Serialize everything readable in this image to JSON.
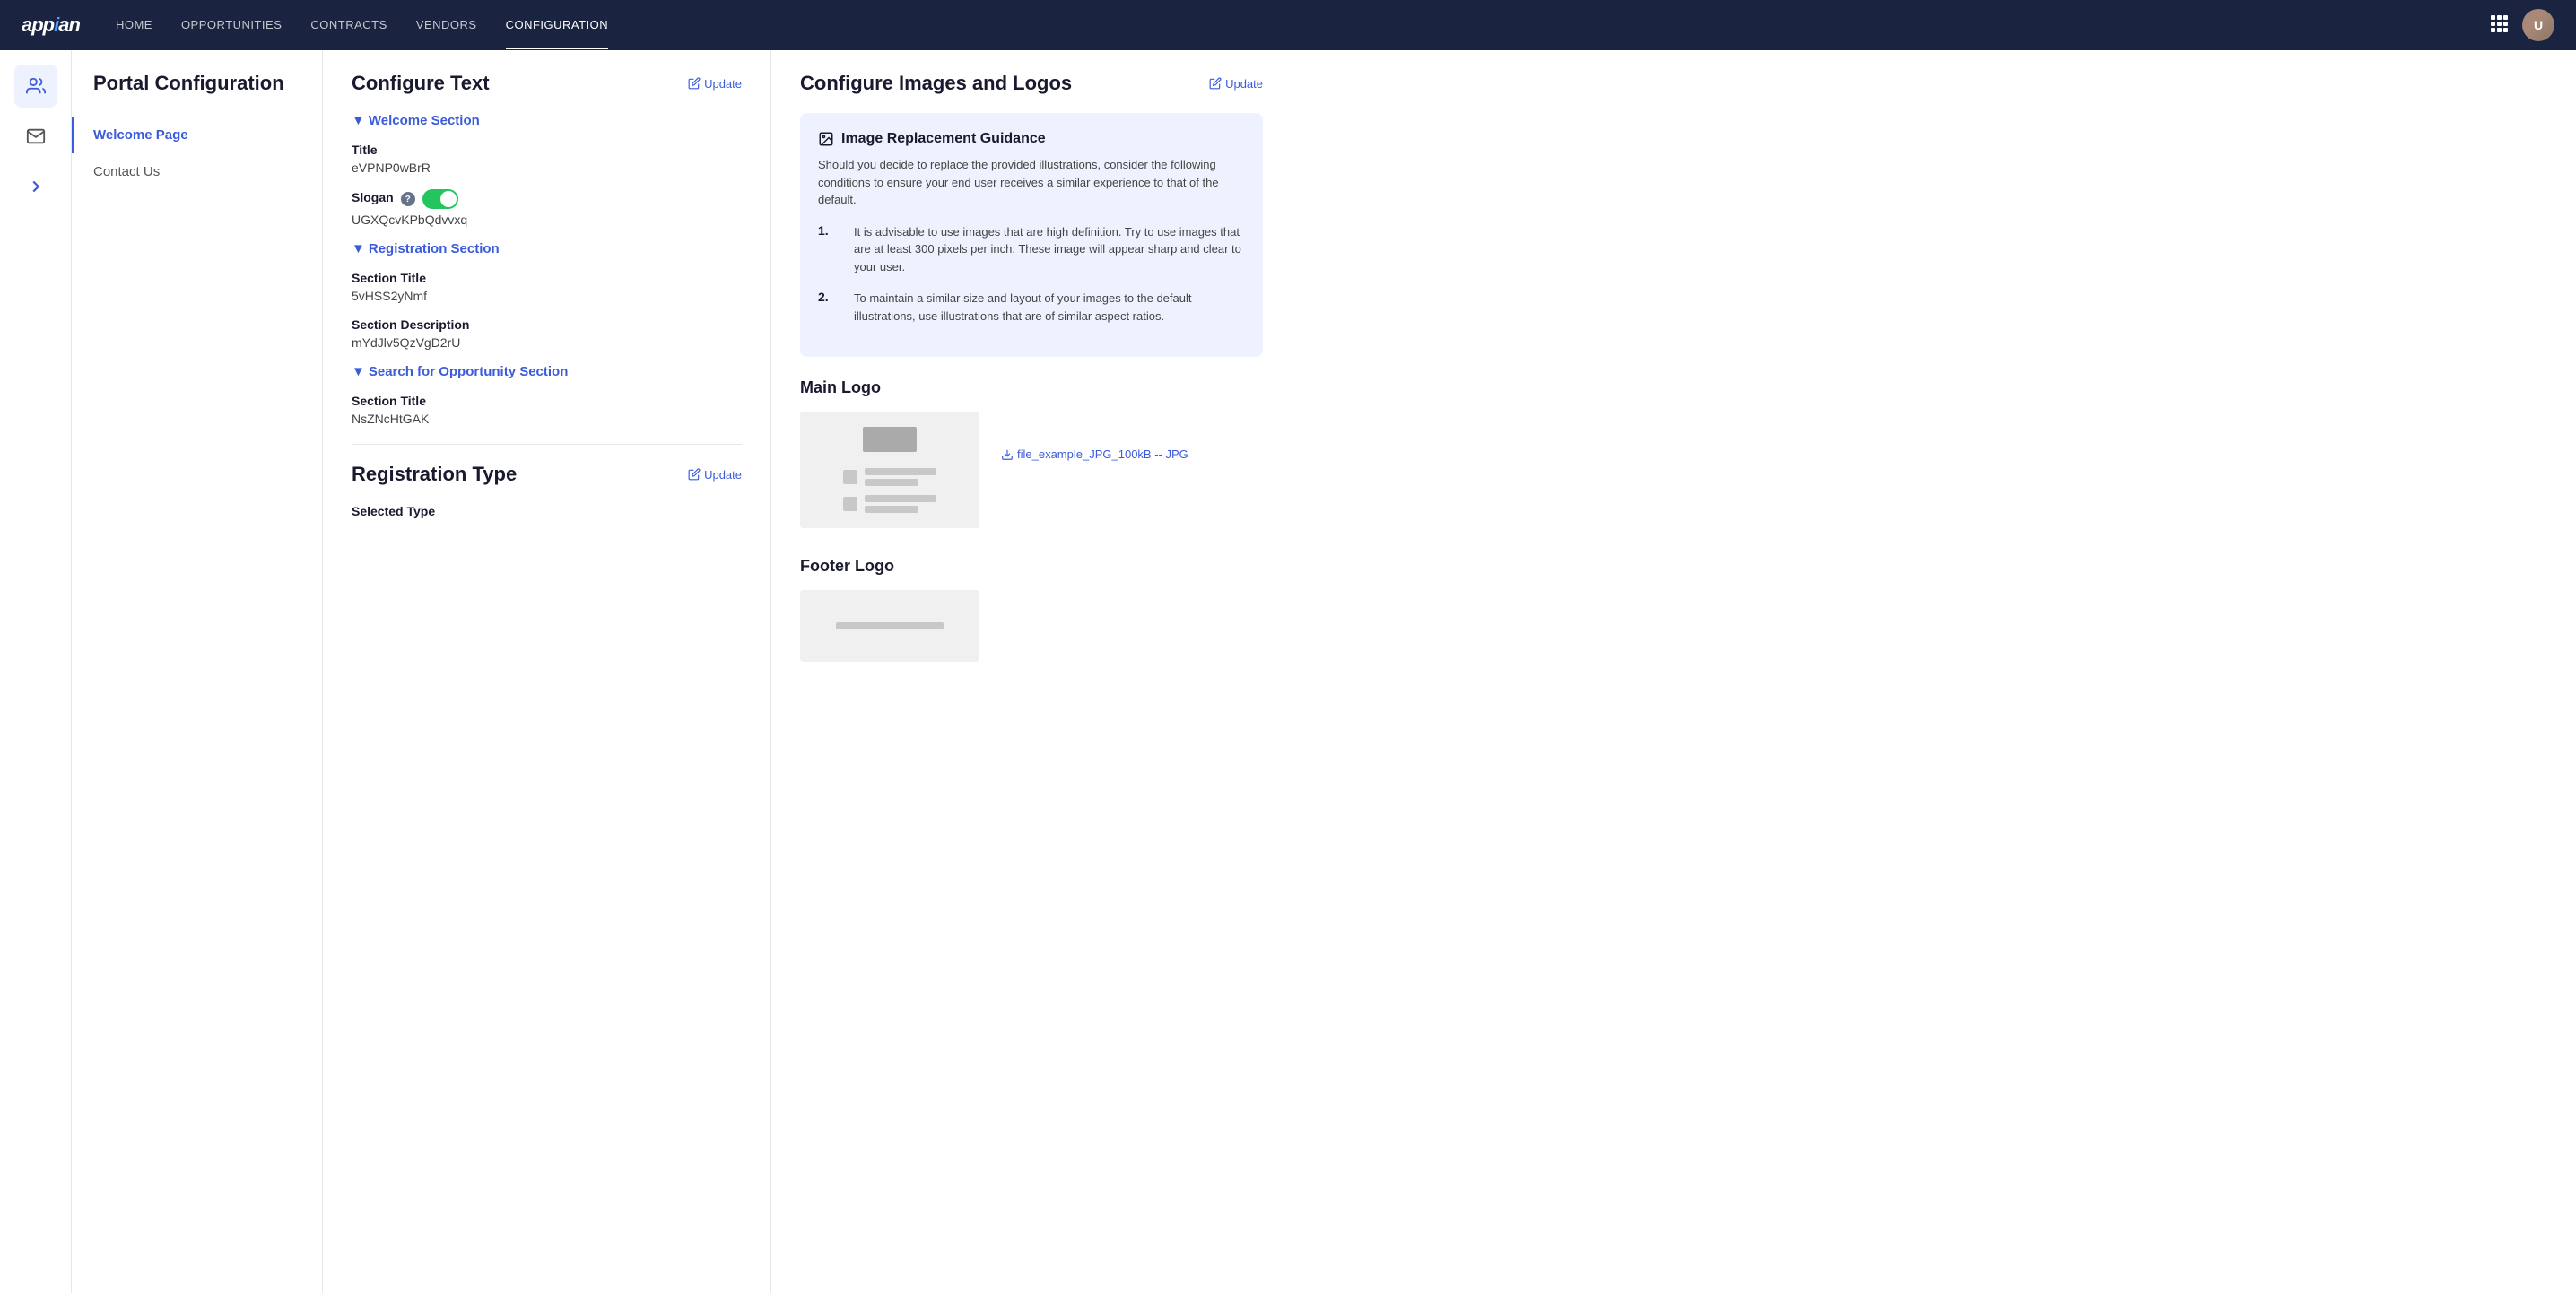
{
  "app": {
    "logo": "appian",
    "nav": {
      "links": [
        {
          "label": "HOME",
          "active": false
        },
        {
          "label": "OPPORTUNITIES",
          "active": false
        },
        {
          "label": "CONTRACTS",
          "active": false
        },
        {
          "label": "VENDORS",
          "active": false
        },
        {
          "label": "CONFIGURATION",
          "active": true
        }
      ]
    }
  },
  "sidebar": {
    "title": "Portal Configuration",
    "items": [
      {
        "label": "Welcome Page",
        "active": true
      },
      {
        "label": "Contact Us",
        "active": false
      }
    ]
  },
  "configure_text": {
    "panel_title": "Configure Text",
    "update_label": "Update",
    "sections": [
      {
        "id": "welcome",
        "label": "Welcome Section",
        "fields": [
          {
            "label": "Title",
            "value": "eVPNP0wBrR"
          },
          {
            "label": "Slogan",
            "value": "UGXQcvKPbQdvvxq",
            "has_toggle": true,
            "has_help": true
          }
        ]
      },
      {
        "id": "registration",
        "label": "Registration Section",
        "fields": [
          {
            "label": "Section Title",
            "value": "5vHSS2yNmf"
          },
          {
            "label": "Section Description",
            "value": "mYdJlv5QzVgD2rU"
          }
        ]
      },
      {
        "id": "search",
        "label": "Search for Opportunity Section",
        "fields": [
          {
            "label": "Section Title",
            "value": "NsZNcHtGAK"
          }
        ]
      }
    ]
  },
  "registration_type": {
    "panel_title": "Registration Type",
    "update_label": "Update",
    "selected_type_label": "Selected Type"
  },
  "configure_images": {
    "panel_title": "Configure Images and Logos",
    "update_label": "Update",
    "guidance": {
      "title": "Image Replacement Guidance",
      "description": "Should you decide to replace the provided illustrations, consider the following conditions to ensure your end user receives a similar experience to that of the default.",
      "items": [
        {
          "num": "1.",
          "text": "It is advisable to use images that are high definition. Try to use images that are at least 300 pixels per inch. These image will appear sharp and clear to your user."
        },
        {
          "num": "2.",
          "text": "To maintain a similar size and layout of your images to the default illustrations, use illustrations that are of similar aspect ratios."
        }
      ]
    },
    "main_logo": {
      "label": "Main Logo",
      "file_name": "file_example_JPG_100kB -- JPG"
    },
    "footer_logo": {
      "label": "Footer Logo"
    }
  }
}
